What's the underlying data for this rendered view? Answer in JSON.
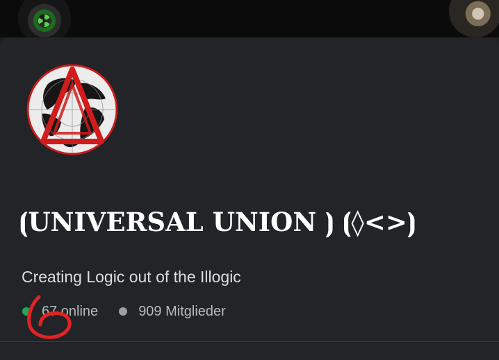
{
  "server": {
    "name": "⦗UNIVERSAL UNION ⦘ ⦗◊<>⦘",
    "description": "Creating Logic out of the Illogic"
  },
  "stats": {
    "online_label": "67 online",
    "members_label": "909 Mitglieder",
    "online_color": "#23a55a",
    "members_color": "#9ba0a8"
  },
  "icons": {
    "avatar": "globe-triangle-logo",
    "top_left": "radiation-server-icon",
    "top_right": "server-icon"
  },
  "annotation": {
    "color": "#e02424",
    "shape": "hand-drawn circle"
  }
}
